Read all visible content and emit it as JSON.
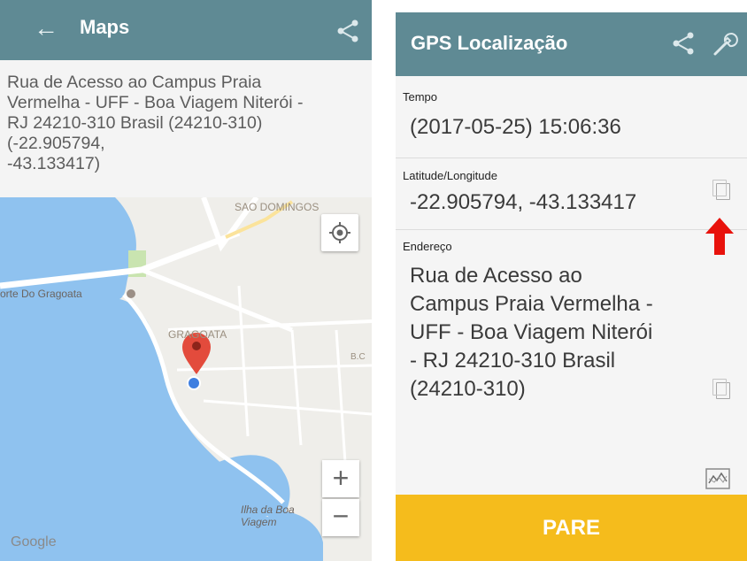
{
  "maps_screen": {
    "title": "Maps",
    "back_icon": "arrow-left-icon",
    "share_icon": "share-icon",
    "address": "Rua de Acesso ao Campus Praia\nVermelha - UFF - Boa Viagem Niterói -\nRJ 24210-310 Brasil (24210-310)\n(-22.905794,\n-43.133417)",
    "map": {
      "labels": {
        "sao_domingos": "SAO DOMINGOS",
        "forte": "orte Do Gragoata",
        "gragoata": "GRAGOATA",
        "ilha": "Ilha da Boa\nViagem",
        "bc": "B.C"
      },
      "zoom_in": "+",
      "zoom_out": "−",
      "logo": "Google",
      "colors": {
        "water": "#8fc2ef",
        "land": "#efeeea",
        "road": "#ffffff",
        "park": "#c9e4b0",
        "pin": "#e34b3c",
        "location_dot": "#3f7fe0"
      }
    }
  },
  "gps_screen": {
    "title": "GPS Localização",
    "share_icon": "share-icon",
    "settings_icon": "wrench-icon",
    "time": {
      "label": "Tempo",
      "value": "(2017-05-25) 15:06:36"
    },
    "latlng": {
      "label": "Latitude/Longitude",
      "value": "-22.905794, -43.133417",
      "copy_icon": "copy-icon"
    },
    "address": {
      "label": "Endereço",
      "value": "Rua de Acesso ao\nCampus Praia Vermelha -\nUFF - Boa Viagem Niterói\n- RJ 24210-310 Brasil\n(24210-310)",
      "copy_icon": "copy-icon"
    },
    "indicator_icon": "red-up-arrow-icon",
    "chart_icon": "chart-icon",
    "stop_button": "PARE",
    "colors": {
      "appbar": "#5f8a94",
      "stop_button": "#f5bc1c",
      "arrow": "#e8120c"
    }
  }
}
